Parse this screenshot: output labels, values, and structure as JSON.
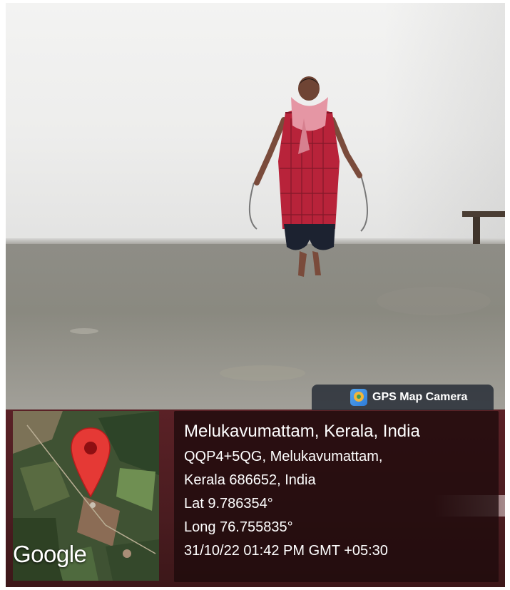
{
  "overlay": {
    "app_badge": "GPS Map Camera",
    "map_brand": "Google",
    "place_title": "Melukavumattam, Kerala, India",
    "address_line_1": "QQP4+5QG, Melukavumattam,",
    "address_line_2": "Kerala 686652, India",
    "latitude": "Lat 9.786354°",
    "longitude": "Long 76.755835°",
    "datetime": "31/10/22 01:42 PM GMT +05:30"
  },
  "icons": {
    "pin": "map-pin-icon",
    "app": "gps-map-camera-icon"
  },
  "colors": {
    "pin_red": "#e53935",
    "panel_bg": "#2a0d10",
    "badge_bg": "#2c323b"
  }
}
